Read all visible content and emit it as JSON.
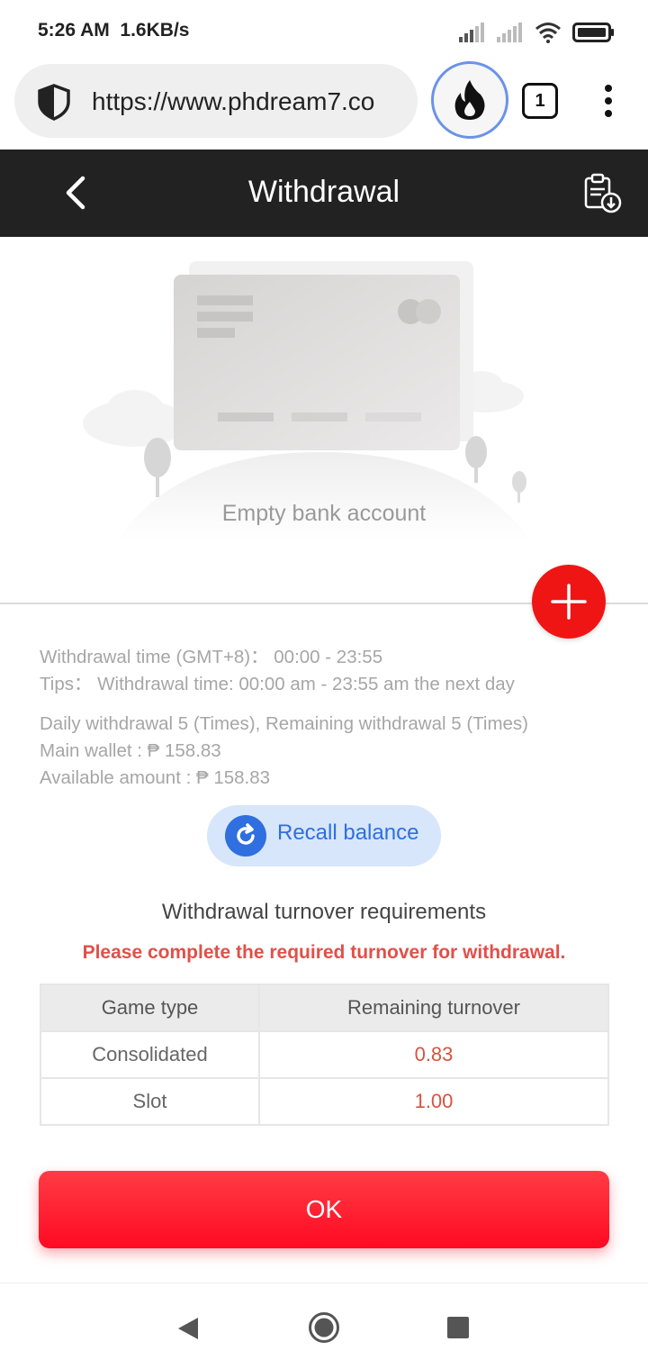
{
  "status_bar": {
    "time": "5:26 AM",
    "speed": "1.6KB/s",
    "icons": [
      "signal-icon",
      "signal-icon",
      "wifi-icon",
      "battery-icon"
    ]
  },
  "browser": {
    "url": "https://www.phdream7.co",
    "tab_count": "1",
    "icons": [
      "shield-icon",
      "fire-icon",
      "menu-icon"
    ]
  },
  "header": {
    "title": "Withdrawal",
    "icons": [
      "back-arrow-icon",
      "records-icon"
    ]
  },
  "bank": {
    "empty_text": "Empty bank account",
    "add_icon": "plus-icon"
  },
  "info": {
    "withdrawal_time": "Withdrawal time (GMT+8)：  00:00 - 23:55",
    "tips": "Tips：  Withdrawal time: 00:00 am - 23:55 am the next day",
    "daily_limit": "Daily withdrawal 5 (Times), Remaining withdrawal 5 (Times)",
    "main_wallet": "Main wallet : ₱ 158.83",
    "available_amount": "Available amount : ₱ 158.83"
  },
  "recall": {
    "label": "Recall balance",
    "icon": "refresh-icon"
  },
  "turnover": {
    "title": "Withdrawal turnover requirements",
    "warning": "Please complete the required turnover for withdrawal.",
    "columns": [
      "Game type",
      "Remaining turnover"
    ],
    "rows": [
      {
        "game": "Consolidated",
        "remaining": "0.83"
      },
      {
        "game": "Slot",
        "remaining": "1.00"
      }
    ]
  },
  "actions": {
    "ok_label": "OK"
  },
  "nav": {
    "icons": [
      "nav-back-icon",
      "nav-home-icon",
      "nav-recent-icon"
    ]
  },
  "colors": {
    "header_bg": "#222222",
    "accent_red": "#f01515",
    "ok_button": "#ff1a30",
    "recall_blue": "#2f6fe0",
    "warning_red": "#e0504a"
  }
}
